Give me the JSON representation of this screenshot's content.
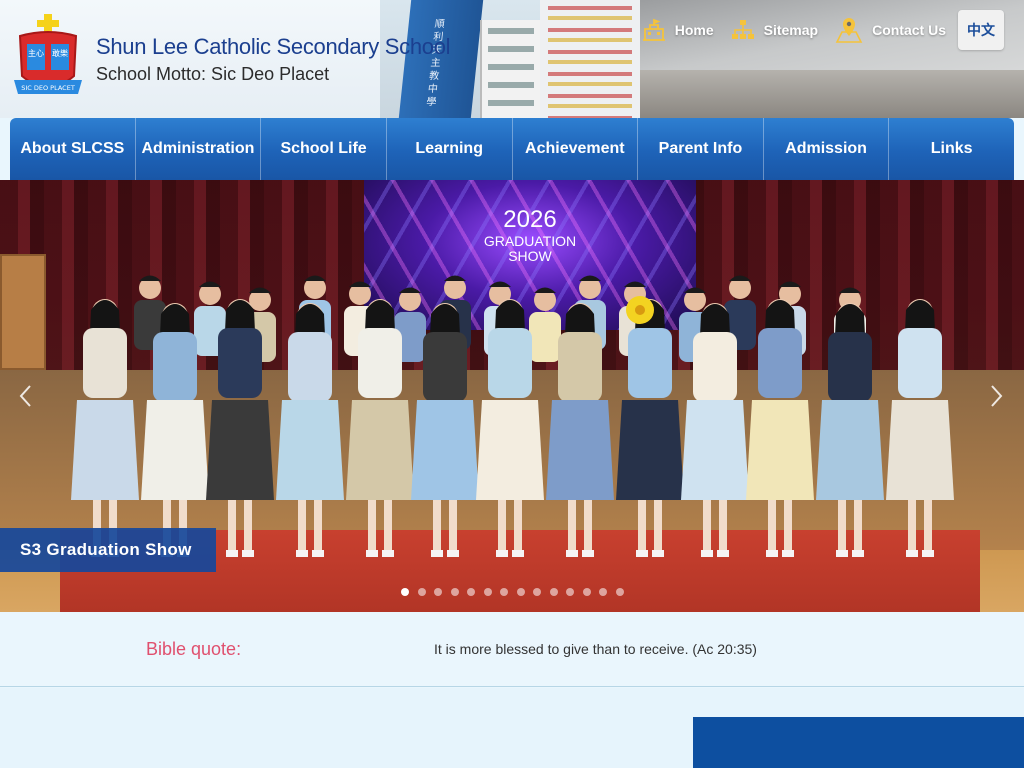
{
  "header": {
    "school_name": "Shun Lee Catholic Secondary School",
    "motto": "School Motto: Sic Deo Placet",
    "tower_text": "順利天主教中學",
    "logo": {
      "left_text": "主心",
      "right_text": "敢樂",
      "ribbon_text": "SIC DEO PLACET"
    },
    "top_links": [
      {
        "label": "Home",
        "icon": "school-building-icon"
      },
      {
        "label": "Sitemap",
        "icon": "sitemap-icon"
      },
      {
        "label": "Contact Us",
        "icon": "map-pin-icon"
      }
    ],
    "language_button": "中文"
  },
  "nav": {
    "items": [
      {
        "label": "About SLCSS"
      },
      {
        "label": "Administration"
      },
      {
        "label": "School Life"
      },
      {
        "label": "Learning"
      },
      {
        "label": "Achievement"
      },
      {
        "label": "Parent Info"
      },
      {
        "label": "Admission"
      },
      {
        "label": "Links"
      }
    ]
  },
  "slider": {
    "screen_year": "2026",
    "screen_title_line1": "GRADUATION",
    "screen_title_line2": "SHOW",
    "caption": "S3 Graduation Show",
    "prev_icon": "chevron-left-icon",
    "next_icon": "chevron-right-icon",
    "slide_count": 14,
    "active_slide": 1
  },
  "quote": {
    "label": "Bible quote:",
    "text": "It is more blessed to give than to receive. (Ac 20:35)"
  },
  "colors": {
    "brand_blue": "#1e63b8",
    "title_blue": "#1b3f8f",
    "quote_label": "#e0506e",
    "caption_bg": "#16489b",
    "band_bg": "#eaf6fd"
  }
}
